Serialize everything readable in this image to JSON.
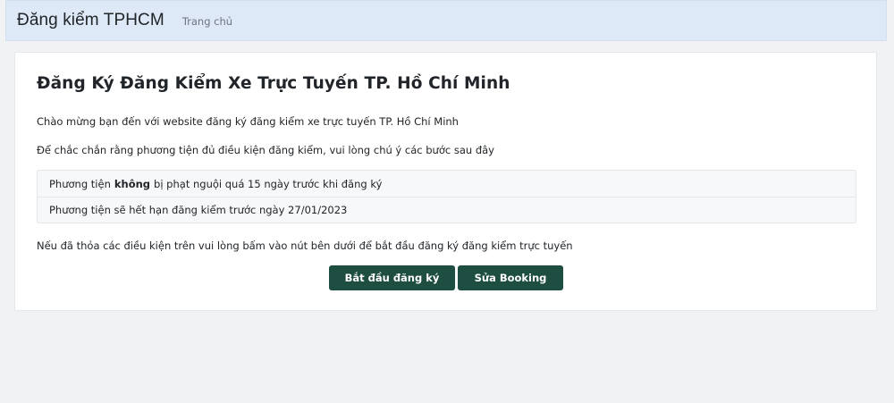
{
  "navbar": {
    "brand": "Đăng kiểm TPHCM",
    "home_link": "Trang chủ"
  },
  "main": {
    "title": "Đăng Ký Đăng Kiểm Xe Trực Tuyến TP. Hồ Chí Minh",
    "welcome": "Chào mừng bạn đến với website đăng ký đăng kiểm xe trực tuyến TP. Hồ Chí Minh",
    "instructions": "Để chắc chắn rằng phương tiện đủ điều kiện đăng kiểm, vui lòng chú ý các bước sau đây",
    "conditions": {
      "item1_prefix": "Phương tiện",
      "item1_bold": "không",
      "item1_suffix": "bị phạt nguội quá 15 ngày trước khi đăng ký",
      "item2": "Phương tiện sẽ hết hạn đăng kiểm trước ngày 27/01/2023"
    },
    "prompt": "Nếu đã thỏa các điều kiện trên vui lòng bấm vào nút bên dưới để bắt đầu đăng ký đăng kiểm trực tuyến",
    "buttons": {
      "start": "Bắt đầu đăng ký",
      "edit": "Sửa Booking"
    }
  }
}
